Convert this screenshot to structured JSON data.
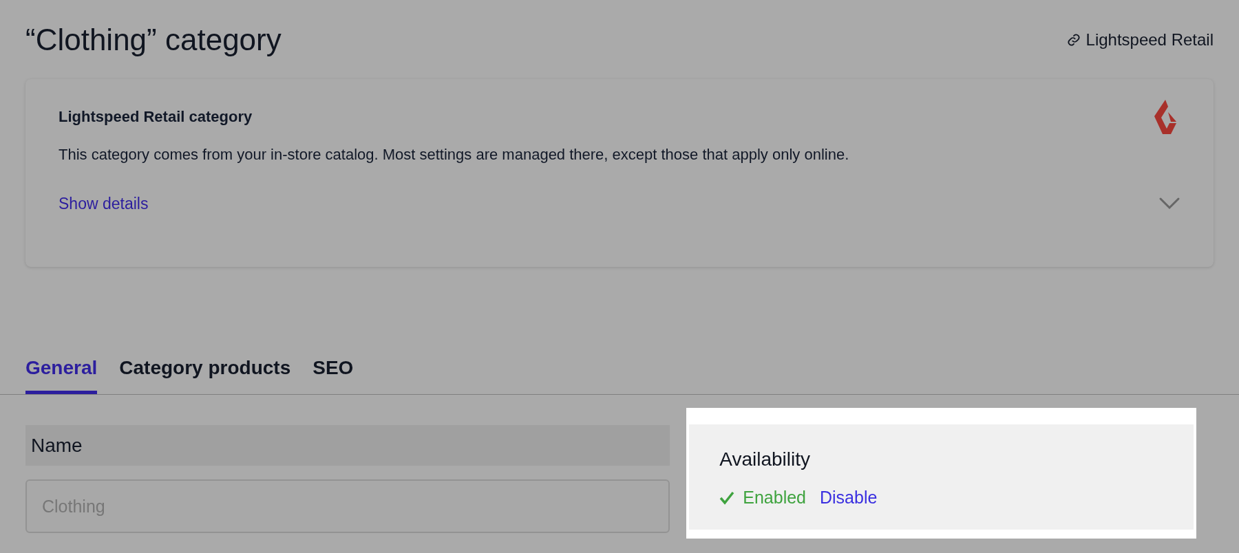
{
  "page": {
    "title": "“Clothing” category",
    "source_link": "Lightspeed Retail"
  },
  "source_card": {
    "heading": "Lightspeed Retail category",
    "description": "This category comes from your in-store catalog. Most settings are managed there, except those that apply only online.",
    "toggle": "Show details",
    "expanded": false
  },
  "tabs": [
    {
      "label": "General",
      "selected": true
    },
    {
      "label": "Category products",
      "selected": false
    },
    {
      "label": "SEO",
      "selected": false
    }
  ],
  "name_field": {
    "label": "Name",
    "value": "Clothing"
  },
  "availability": {
    "heading": "Availability",
    "enabled": true,
    "status": "Enabled",
    "action": "Disable"
  }
}
